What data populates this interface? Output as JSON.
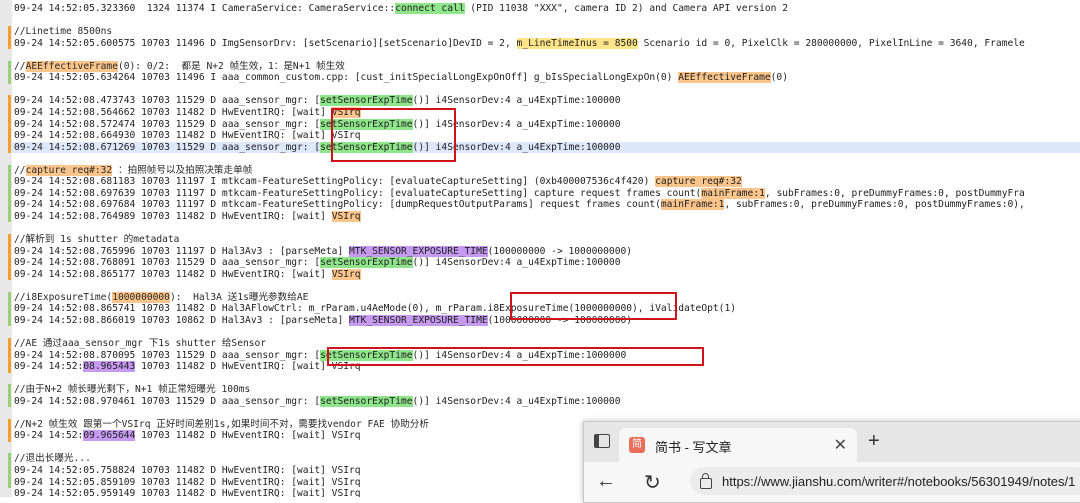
{
  "log": {
    "lines": [
      {
        "text": "09-24 14:52:05.323360  1324 11374 I CameraService: CameraService::",
        "hl": "connect call",
        "hl2": " (PID 11038 \"XXX\", camera ID 2) and Camera API version 2"
      },
      {
        "text": ""
      },
      {
        "text": "//Linetime 8500ns"
      },
      {
        "text": "09-24 14:52:05.600575 10703 11496 D ImgSensorDrv: [setScenario][setScenario]DevID = 2, ",
        "hl": "m_LineTimeInus = 8500",
        "hl2": " Scenario id = 0, PixelClk = 280000000, PixelInLine = 3640, Framele"
      },
      {
        "text": ""
      },
      {
        "text": "//",
        "hl": "AEEffectiveFrame",
        "hl2": "(0): 0/2:  都是 N+2 帧生效，1：是N+1 帧生效"
      },
      {
        "text": "09-24 14:52:05.634264 10703 11496 I aaa_common_custom.cpp: [cust_initSpecialLongExpOnOff] g_bIsSpecialLongExpOn(0) ",
        "hl": "AEEffectiveFrame",
        "hl2": "(0)"
      },
      {
        "text": ""
      },
      {
        "text": "09-24 14:52:08.473743 10703 11529 D aaa_sensor_mgr: [",
        "hl": "setSensorExpTime",
        "hl2": "()] i4SensorDev:4 a_u4ExpTime:100000"
      },
      {
        "text": "09-24 14:52:08.564662 10703 11482 D HwEventIRQ: [wait] ",
        "hl": "VSIrq",
        "hl2": ""
      },
      {
        "text": "09-24 14:52:08.572474 10703 11529 D aaa_sensor_mgr: [",
        "hl": "setSensorExpTime",
        "hl2": "()] i4SensorDev:4 a_u4ExpTime:100000"
      },
      {
        "text": "09-24 14:52:08.664930 10703 11482 D HwEventIRQ: [wait] VSIrq"
      },
      {
        "text": "09-24 14:52:08.671269 10703 11529 D aaa_sensor_mgr: [",
        "hl": "setSensorExpTime",
        "hl2": "()] i4SensorDev:4 a_u4ExpTime:100000"
      },
      {
        "text": ""
      },
      {
        "text": "//",
        "hl": "capture req#:32",
        "hl2": " ：拍照帧号以及拍照决策走单帧"
      },
      {
        "text": "09-24 14:52:08.681183 10703 11197 I mtkcam-FeatureSettingPolicy: [evaluateCaptureSetting] (0xb400007536c4f420) ",
        "hl": "capture req#:32",
        "hl2": ""
      },
      {
        "text": "09-24 14:52:08.697639 10703 11197 D mtkcam-FeatureSettingPolicy: [evaluateCaptureSetting] capture request frames count(",
        "hl": "mainFrame:1",
        "hl2": ", subFrames:0, preDummyFrames:0, postDummyFra"
      },
      {
        "text": "09-24 14:52:08.697684 10703 11197 D mtkcam-FeatureSettingPolicy: [dumpRequestOutputParams] request frames count(",
        "hl": "mainFrame:1",
        "hl2": ", subFrames:0, preDummyFrames:0, postDummyFrames:0),"
      },
      {
        "text": "09-24 14:52:08.764989 10703 11482 D HwEventIRQ: [wait] ",
        "hl": "VSIrq",
        "hl2": ""
      },
      {
        "text": ""
      },
      {
        "text": "//解析到 1s shutter 的metadata"
      },
      {
        "text": "09-24 14:52:08.765996 10703 11197 D Hal3Av3 : [parseMeta] ",
        "hl": "MTK_SENSOR_EXPOSURE_TIME",
        "hl2": "(100000000 -> 1000000000)"
      },
      {
        "text": "09-24 14:52:08.768091 10703 11529 D aaa_sensor_mgr: [",
        "hl": "setSensorExpTime",
        "hl2": "()] i4SensorDev:4 a_u4ExpTime:100000"
      },
      {
        "text": "09-24 14:52:08.865177 10703 11482 D HwEventIRQ: [wait] ",
        "hl": "VSIrq",
        "hl2": ""
      },
      {
        "text": ""
      },
      {
        "text": "//i8ExposureTime(",
        "hl": "1000000000",
        "hl2": "):  Hal3A 送1s曝光参数给AE"
      },
      {
        "text": "09-24 14:52:08.865741 10703 11482 D Hal3AFlowCtrl: m_rParam.u4AeMode(0), m_rParam.i8ExposureTime(1000000000), iValidateOpt(1)"
      },
      {
        "text": "09-24 14:52:08.866019 10703 10862 D Hal3Av3 : [parseMeta] ",
        "hl": "MTK_SENSOR_EXPOSURE_TIME",
        "hl2": "(1000000000 -> 100000000)"
      },
      {
        "text": ""
      },
      {
        "text": "//AE 通过aaa_sensor_mgr 下1s shutter 给Sensor"
      },
      {
        "text": "09-24 14:52:08.870095 10703 11529 D aaa_sensor_mgr: [",
        "hl": "setSensorExpTime",
        "hl2": "()] i4SensorDev:4 a_u4ExpTime:1000000"
      },
      {
        "text": "09-24 14:52:",
        "hl": "08.965443",
        "hl2": " 10703 11482 D HwEventIRQ: [wait] VSIrq"
      },
      {
        "text": ""
      },
      {
        "text": "//由于N+2 帧长曝光剩下，N+1 帧正常短曝光 100ms"
      },
      {
        "text": "09-24 14:52:08.970461 10703 11529 D aaa_sensor_mgr: [",
        "hl": "setSensorExpTime",
        "hl2": "()] i4SensorDev:4 a_u4ExpTime:100000"
      },
      {
        "text": ""
      },
      {
        "text": "//N+2 帧生效 跟第一个VSIrq 正好时间差别1s,如果时间不对，需要找vendor FAE 协助分析"
      },
      {
        "text": "09-24 14:52:",
        "hl": "09.965644",
        "hl2": " 10703 11482 D HwEventIRQ: [wait] VSIrq"
      },
      {
        "text": ""
      },
      {
        "text": "//退出长曝光..."
      },
      {
        "text": "09-24 14:52:05.758824 10703 11482 D HwEventIRQ: [wait] VSIrq"
      },
      {
        "text": "09-24 14:52:05.859109 10703 11482 D HwEventIRQ: [wait] VSIrq"
      },
      {
        "text": "09-24 14:52:05.959149 10703 11482 D HwEventIRQ: [wait] VSIrq"
      }
    ]
  },
  "browser": {
    "tab_title": "简书 - 写文章",
    "favicon_text": "简",
    "url": "https://www.jianshu.com/writer#/notebooks/56301949/notes/1",
    "close_glyph": "✕",
    "newtab_glyph": "+",
    "back_glyph": "←",
    "reload_glyph": "↻"
  }
}
